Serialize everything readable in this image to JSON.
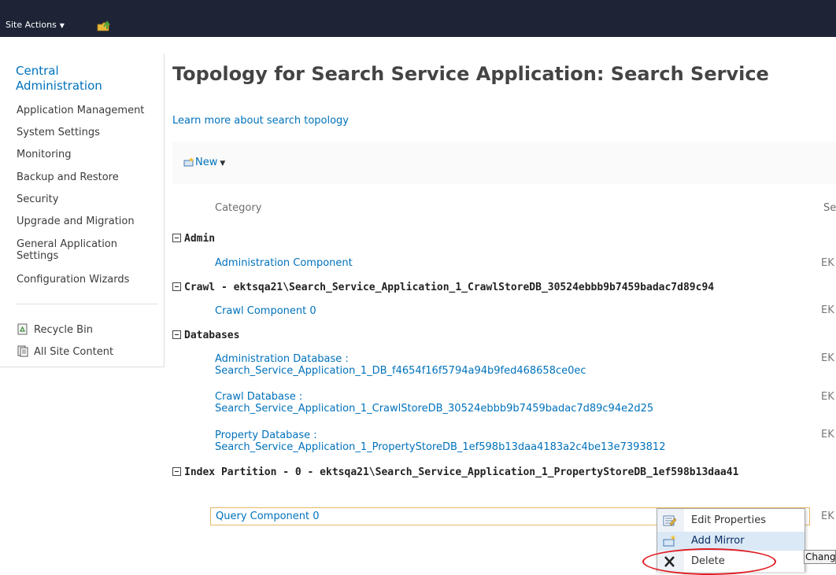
{
  "ribbon": {
    "site_actions": "Site Actions",
    "icons": [
      "caret-down-icon",
      "navigate-up-icon"
    ]
  },
  "sidebar": {
    "central": "Central\nAdministration",
    "items": [
      "Application Management",
      "System Settings",
      "Monitoring",
      "Backup and Restore",
      "Security",
      "Upgrade and Migration",
      "General Application\nSettings",
      "Configuration Wizards"
    ],
    "quick": [
      {
        "label": "Recycle Bin",
        "icon": "recycle-bin-icon"
      },
      {
        "label": "All Site Content",
        "icon": "all-site-content-icon"
      }
    ]
  },
  "page": {
    "title": "Topology for Search Service Application: Search Service",
    "learn_more": "Learn more about search topology",
    "new_label": "New"
  },
  "table": {
    "col_category": "Category",
    "col_server": "Se",
    "server_prefix": "EK",
    "groups": [
      {
        "label": "Admin"
      },
      {
        "label": "Crawl - ektsqa21\\Search_Service_Application_1_CrawlStoreDB_30524ebbb9b7459badac7d89c94"
      },
      {
        "label": "Databases"
      },
      {
        "label": "Index Partition - 0 - ektsqa21\\Search_Service_Application_1_PropertyStoreDB_1ef598b13daa41"
      }
    ],
    "rows": [
      {
        "line1": "Administration Component",
        "line2": ""
      },
      {
        "line1": "Crawl Component 0",
        "line2": ""
      },
      {
        "line1": "Administration Database :",
        "line2": "Search_Service_Application_1_DB_f4654f16f5794a94b9fed468658ce0ec"
      },
      {
        "line1": "Crawl Database :",
        "line2": "Search_Service_Application_1_CrawlStoreDB_30524ebbb9b7459badac7d89c94e2d25"
      },
      {
        "line1": "Property Database :",
        "line2": "Search_Service_Application_1_PropertyStoreDB_1ef598b13daa4183a2c4be13e7393812"
      }
    ],
    "query_component": "Query Component 0"
  },
  "context_menu": {
    "items": [
      {
        "label": "Edit Properties",
        "icon": "edit-properties-icon"
      },
      {
        "label": "Add Mirror",
        "icon": "add-mirror-icon"
      },
      {
        "label": "Delete",
        "icon": "delete-x-icon"
      }
    ],
    "highlighted": "Add Mirror"
  },
  "apply_button": "Chang",
  "colors": {
    "topbar": "#1e2436",
    "link": "#0072bc",
    "highlight_oval": "#e01b22"
  }
}
